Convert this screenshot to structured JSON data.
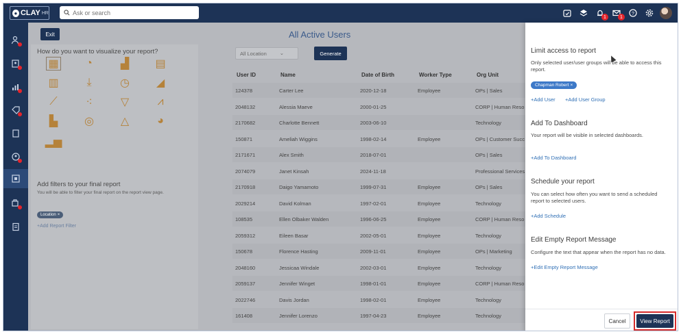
{
  "app": {
    "logo_text": "CLAY",
    "logo_sub": "HR"
  },
  "search": {
    "placeholder": "Ask or search"
  },
  "top_icons": [
    {
      "name": "calendar-check-icon"
    },
    {
      "name": "layers-icon"
    },
    {
      "name": "bell-icon",
      "badge": "1"
    },
    {
      "name": "mail-icon",
      "badge": "1"
    },
    {
      "name": "help-icon"
    },
    {
      "name": "gear-icon"
    }
  ],
  "page": {
    "title": "All Active Users",
    "exit_label": "Exit"
  },
  "viz": {
    "title": "How do you want to visualize your report?",
    "filters_title": "Add filters to your final report",
    "filters_desc": "You will be able to filter your final report on the report view page.",
    "filter_chip": "Location",
    "add_filter": "+Add Report Filter"
  },
  "toolbar": {
    "location_value": "All Location",
    "generate_label": "Generate"
  },
  "table": {
    "headers": [
      "User ID",
      "Name",
      "Date of Birth",
      "Worker Type",
      "Org Unit"
    ],
    "rows": [
      [
        "124378",
        "Carter Lee",
        "2020-12-18",
        "Employee",
        "OPs | Sales"
      ],
      [
        "2048132",
        "Alessia Maeve",
        "2000-01-25",
        "",
        "CORP | Human Reso"
      ],
      [
        "2170682",
        "Charlotte Bennett",
        "2003-06-10",
        "",
        "Technology"
      ],
      [
        "150871",
        "Ameliah Wiggins",
        "1998-02-14",
        "Employee",
        "OPs | Customer Succ"
      ],
      [
        "2171671",
        "Alex Smith",
        "2018-07-01",
        "",
        "OPs | Sales"
      ],
      [
        "2074079",
        "Janet Kinsah",
        "2024-11-18",
        "",
        "Professional Services"
      ],
      [
        "2170918",
        "Daigo Yamamoto",
        "1999-07-31",
        "Employee",
        "OPs | Sales"
      ],
      [
        "2029214",
        "David Kolman",
        "1997-02-01",
        "Employee",
        "Technology"
      ],
      [
        "108535",
        "Ellen Olbaker Walden",
        "1996-06-25",
        "Employee",
        "CORP | Human Reso"
      ],
      [
        "2059312",
        "Eileen Basar",
        "2002-05-01",
        "Employee",
        "Technology"
      ],
      [
        "150678",
        "Florence Hasting",
        "2009-11-01",
        "Employee",
        "OPs | Marketing"
      ],
      [
        "2048160",
        "Jessicaa Windale",
        "2002-03-01",
        "Employee",
        "Technology"
      ],
      [
        "2059137",
        "Jennifer Winget",
        "1998-01-01",
        "Employee",
        "CORP | Human Reso"
      ],
      [
        "2022746",
        "Davis Jordan",
        "1998-02-01",
        "Employee",
        "Technology"
      ],
      [
        "161408",
        "Jennifer Lorenzo",
        "1997-04-23",
        "Employee",
        "Technology"
      ]
    ]
  },
  "panel": {
    "limit_title": "Limit access to report",
    "limit_desc": "Only selected user/user groups will be able to access this report.",
    "user_chip": "Chapman Robert",
    "add_user": "+Add User",
    "add_user_group": "+Add User Group",
    "dashboard_title": "Add To Dashboard",
    "dashboard_desc": "Your report will be visible in selected dashboards.",
    "add_dashboard": "+Add To Dashboard",
    "schedule_title": "Schedule your report",
    "schedule_desc": "You can select how often you want to send a scheduled report to selected users.",
    "add_schedule": "+Add Schedule",
    "empty_title": "Edit Empty Report Message",
    "empty_desc": "Configure the text that appear when the report has no data.",
    "edit_empty": "+Edit Empty Report Message",
    "cancel_label": "Cancel",
    "view_label": "View Report"
  },
  "colors": {
    "nav": "#1d3356",
    "accent": "#2f6fb5",
    "highlight": "#d62b2b",
    "badge": "#e4242b"
  }
}
